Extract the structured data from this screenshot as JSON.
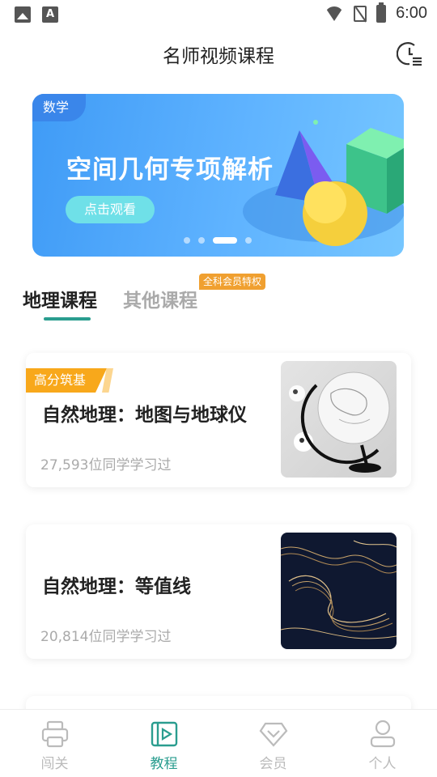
{
  "status_bar": {
    "time": "6:00",
    "a_icon_glyph": "A",
    "icons": [
      "image-icon",
      "a-icon",
      "wifi-icon",
      "no-sim-icon",
      "battery-icon"
    ]
  },
  "header": {
    "title": "名师视频课程",
    "history_icon": "clock-list-icon"
  },
  "banner": {
    "tag": "数学",
    "title": "空间几何专项解析",
    "button_label": "点击观看",
    "pages": 4,
    "active_page": 3
  },
  "tabs": {
    "items": [
      {
        "label": "地理课程",
        "active": true
      },
      {
        "label": "其他课程",
        "active": false
      }
    ],
    "vip_badge": "全科会员特权"
  },
  "courses": [
    {
      "ribbon": "高分筑基",
      "title": "自然地理：地图与地球仪",
      "learners": "27,593位同学学习过",
      "thumb": "globe"
    },
    {
      "ribbon": "",
      "title": "自然地理：等值线",
      "learners": "20,814位同学学习过",
      "thumb": "contour-lines"
    }
  ],
  "bottom_nav": {
    "items": [
      {
        "label": "闯关",
        "icon": "printer-icon",
        "active": false
      },
      {
        "label": "教程",
        "icon": "video-book-icon",
        "active": true
      },
      {
        "label": "会员",
        "icon": "diamond-icon",
        "active": false
      },
      {
        "label": "个人",
        "icon": "person-icon",
        "active": false
      }
    ]
  },
  "colors": {
    "accent": "#2a9d8f",
    "banner_blue": "#4fa9fa",
    "ribbon_orange": "#f8a81b",
    "vip_orange": "#f0a030"
  }
}
